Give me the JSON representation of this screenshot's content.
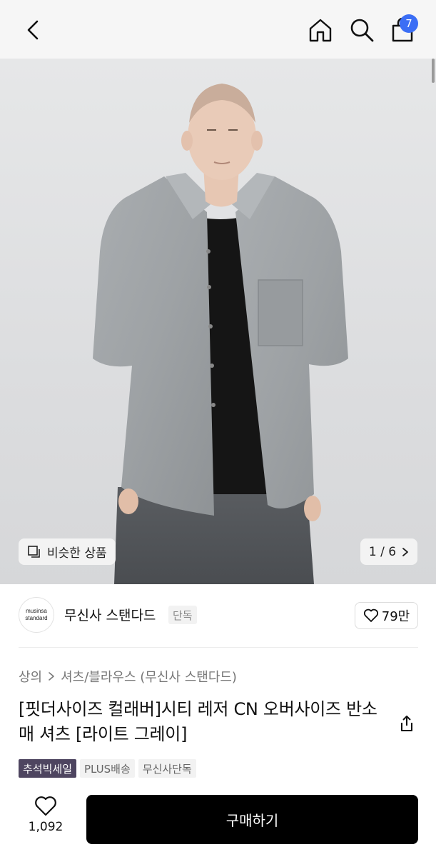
{
  "header": {
    "cart_count": "7"
  },
  "gallery": {
    "similar_label": "비슷한 상품",
    "pager": "1 / 6"
  },
  "brand": {
    "logo_line1": "musinsa",
    "logo_line2": "standard",
    "name": "무신사 스탠다드",
    "tag": "단독",
    "like_count": "79만"
  },
  "breadcrumb": {
    "level1": "상의",
    "level2": "셔츠/블라우스 (무신사 스탠다드)"
  },
  "product": {
    "title": "[핏더사이즈 컬래버]시티 레저 CN 오버사이즈 반소매 셔츠 [라이트 그레이]",
    "badges": [
      "추석빅세일",
      "PLUS배송",
      "무신사단독"
    ]
  },
  "bottom": {
    "like_count": "1,092",
    "buy_label": "구매하기"
  },
  "colors": {
    "badge_accent": "#3b6ef5",
    "sale_badge": "#4e4560",
    "buy_button": "#000000"
  }
}
